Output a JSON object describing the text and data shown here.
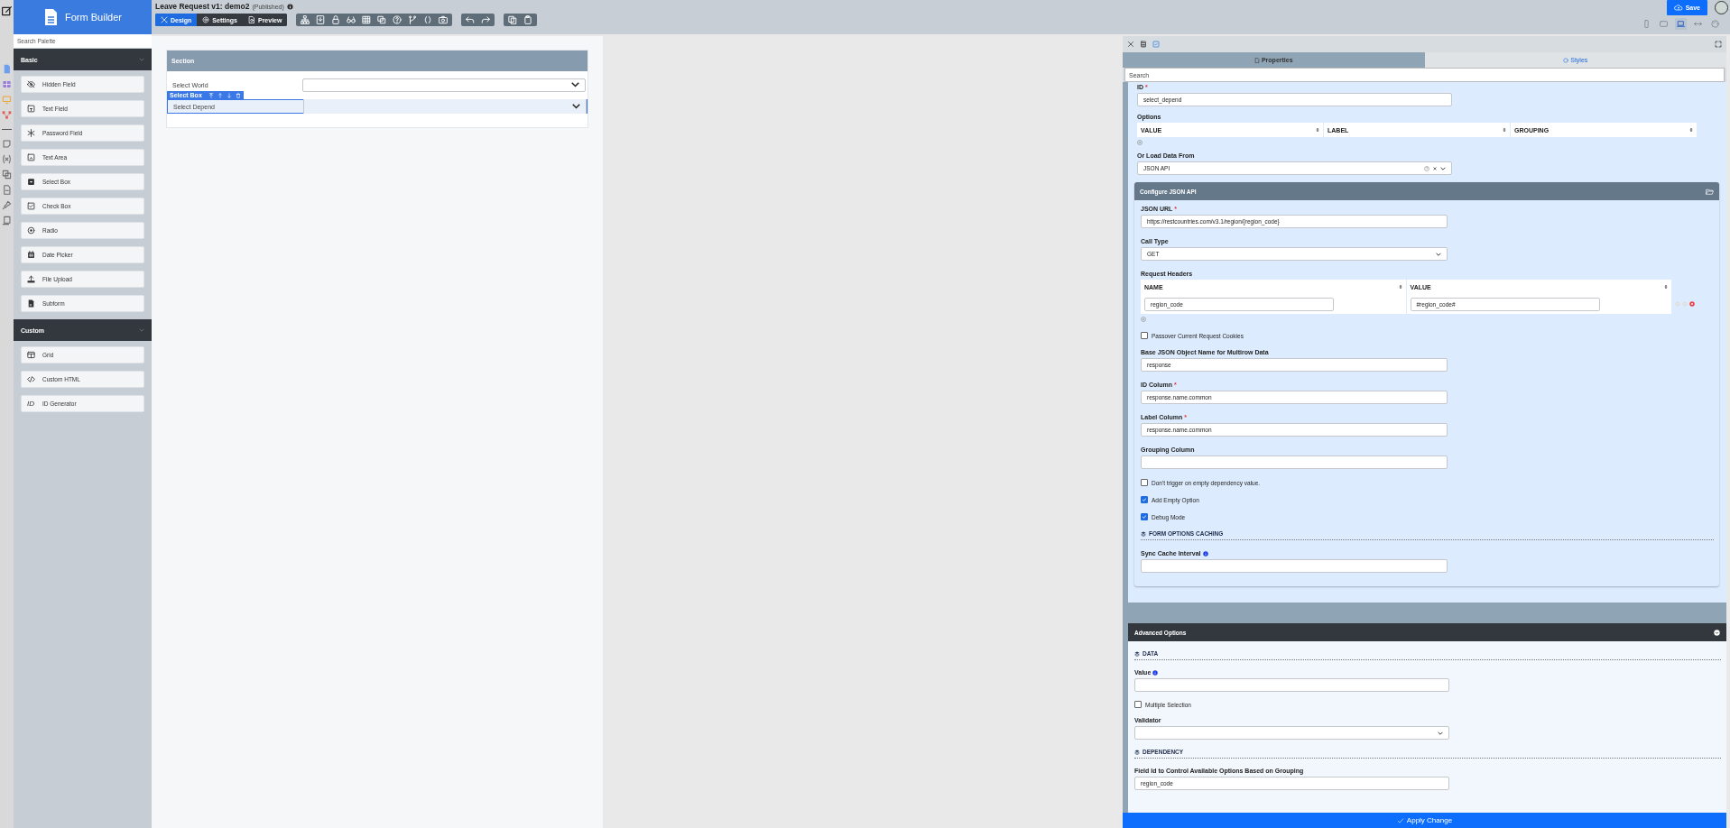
{
  "palette": {
    "title": "Form Builder",
    "search_placeholder": "Search Palette",
    "groups": [
      {
        "name": "Basic",
        "items": [
          {
            "label": "Hidden Field",
            "kind": "hidden"
          },
          {
            "label": "Text Field",
            "kind": "text"
          },
          {
            "label": "Password Field",
            "kind": "password"
          },
          {
            "label": "Text Area",
            "kind": "textarea"
          },
          {
            "label": "Select Box",
            "kind": "select"
          },
          {
            "label": "Check Box",
            "kind": "checkbox"
          },
          {
            "label": "Radio",
            "kind": "radio"
          },
          {
            "label": "Date Picker",
            "kind": "date"
          },
          {
            "label": "File Upload",
            "kind": "file"
          },
          {
            "label": "Subform",
            "kind": "subform"
          }
        ]
      },
      {
        "name": "Custom",
        "items": [
          {
            "label": "Grid",
            "kind": "grid"
          },
          {
            "label": "Custom HTML",
            "kind": "html"
          },
          {
            "label": "ID Generator",
            "kind": "id",
            "icon_text": "ID"
          }
        ]
      }
    ]
  },
  "document": {
    "title": "Leave Request v1: demo2",
    "status": "(Published)"
  },
  "mode_tabs": [
    {
      "label": "Design",
      "selected": true
    },
    {
      "label": "Settings",
      "selected": false
    },
    {
      "label": "Preview",
      "selected": false
    }
  ],
  "save_button": "Save",
  "devices": [
    {
      "kind": "phone",
      "selected": false
    },
    {
      "kind": "tablet",
      "selected": false
    },
    {
      "kind": "laptop",
      "selected": true
    },
    {
      "kind": "full",
      "selected": false
    },
    {
      "kind": "theme",
      "selected": false
    }
  ],
  "section": {
    "title": "Section",
    "element_toolbar": "Select Box",
    "fields": [
      {
        "label": "Select World",
        "selected": false
      },
      {
        "label": "Select Depend",
        "selected": true
      }
    ]
  },
  "panel_tabs": [
    {
      "label": "Properties",
      "selected": true
    },
    {
      "label": "Styles",
      "selected": false
    }
  ],
  "panel_search": {
    "placeholder": "Search"
  },
  "properties": [
    {
      "kind": "input",
      "label": "ID",
      "required_mark": "*",
      "value": "select_depend"
    },
    {
      "kind": "table",
      "label": "Options",
      "columns": [
        "VALUE",
        "LABEL",
        "GROUPING"
      ]
    },
    {
      "kind": "combo",
      "label": "Or Load Data From",
      "value": "JSON API"
    }
  ],
  "json_api": {
    "title": "Configure JSON API",
    "fields": [
      {
        "kind": "input",
        "label": "JSON URL",
        "required_mark": "*",
        "value": "https://restcountries.com/v3.1/region/{region_code}"
      },
      {
        "kind": "select",
        "label": "Call Type",
        "value": "GET"
      },
      {
        "kind": "header_table",
        "label": "Request Headers",
        "columns": [
          "NAME",
          "VALUE"
        ],
        "rows": [
          [
            "region_code",
            "#region_code#"
          ]
        ]
      },
      {
        "kind": "checkbox",
        "label": "Passover Current Request Cookies",
        "checked": false
      },
      {
        "kind": "input",
        "label": "Base JSON Object Name for Multirow Data",
        "value": "response"
      },
      {
        "kind": "input",
        "label": "ID Column",
        "required_mark": "*",
        "value": "response.name.common"
      },
      {
        "kind": "input",
        "label": "Label Column",
        "required_mark": "*",
        "value": "response.name.common"
      },
      {
        "kind": "input",
        "label": "Grouping Column"
      },
      {
        "kind": "checkbox",
        "label": "Don't trigger on empty dependency value.",
        "checked": false
      },
      {
        "kind": "checkbox",
        "label": "Add Empty Option",
        "checked": true
      },
      {
        "kind": "checkbox",
        "label": "Debug Mode",
        "checked": true
      },
      {
        "kind": "heading",
        "label": "FORM OPTIONS CACHING"
      },
      {
        "kind": "input",
        "label": "Sync Cache Interval",
        "info": true
      }
    ]
  },
  "advanced": {
    "title": "Advanced Options",
    "fields": [
      {
        "kind": "heading",
        "label": "DATA"
      },
      {
        "kind": "input",
        "label": "Value",
        "info": true
      },
      {
        "kind": "checkbox",
        "label": "Multiple Selection",
        "checked": false
      },
      {
        "kind": "select",
        "label": "Validator"
      },
      {
        "kind": "heading",
        "label": "DEPENDENCY"
      },
      {
        "kind": "input",
        "label": "Field Id to Control Available Options Based on Grouping",
        "value": "region_code"
      }
    ]
  },
  "apply_button": "Apply Change"
}
